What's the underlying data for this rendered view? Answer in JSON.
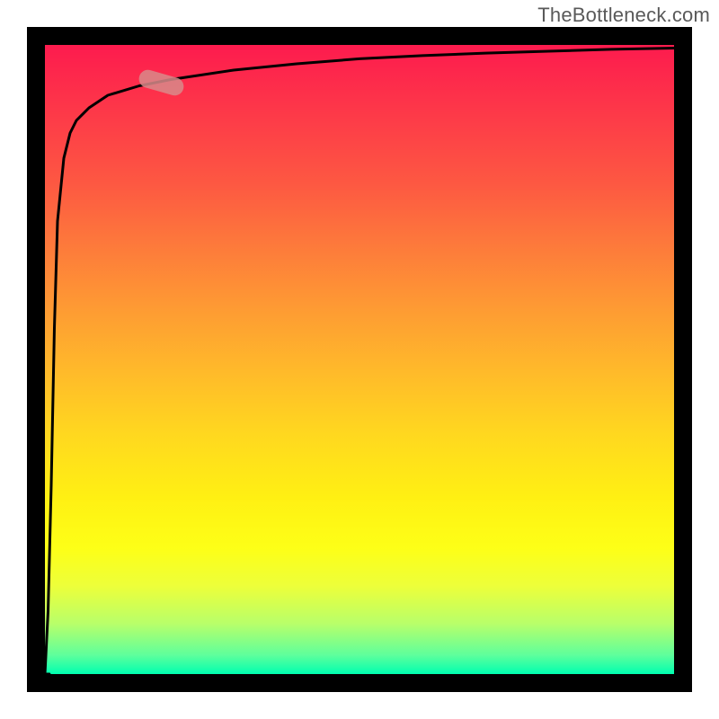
{
  "attribution": "TheBottleneck.com",
  "chart_data": {
    "type": "line",
    "title": "",
    "xlabel": "",
    "ylabel": "",
    "xlim": [
      0,
      100
    ],
    "ylim": [
      0,
      100
    ],
    "x": [
      0,
      0.5,
      1,
      1.5,
      2,
      3,
      4,
      5,
      7,
      10,
      15,
      20,
      30,
      40,
      50,
      60,
      70,
      80,
      90,
      100
    ],
    "values": [
      0,
      10,
      30,
      55,
      72,
      82,
      86,
      88,
      90,
      92,
      93.5,
      94.5,
      96,
      97,
      97.8,
      98.3,
      98.7,
      99,
      99.3,
      99.5
    ],
    "highlight_region": {
      "x_start": 15,
      "x_end": 22,
      "y_start": 93,
      "y_end": 95
    },
    "gradient_stops": [
      {
        "pos": 0,
        "color": "#fd1b4e"
      },
      {
        "pos": 12,
        "color": "#fd3c48"
      },
      {
        "pos": 22,
        "color": "#fd5842"
      },
      {
        "pos": 32,
        "color": "#fd7a3b"
      },
      {
        "pos": 42,
        "color": "#fe9b33"
      },
      {
        "pos": 52,
        "color": "#ffba2a"
      },
      {
        "pos": 62,
        "color": "#ffd81f"
      },
      {
        "pos": 72,
        "color": "#fff013"
      },
      {
        "pos": 80,
        "color": "#fdff17"
      },
      {
        "pos": 86,
        "color": "#edff3a"
      },
      {
        "pos": 92,
        "color": "#b8ff6a"
      },
      {
        "pos": 97,
        "color": "#5eff9c"
      },
      {
        "pos": 100,
        "color": "#00ffb0"
      }
    ]
  }
}
